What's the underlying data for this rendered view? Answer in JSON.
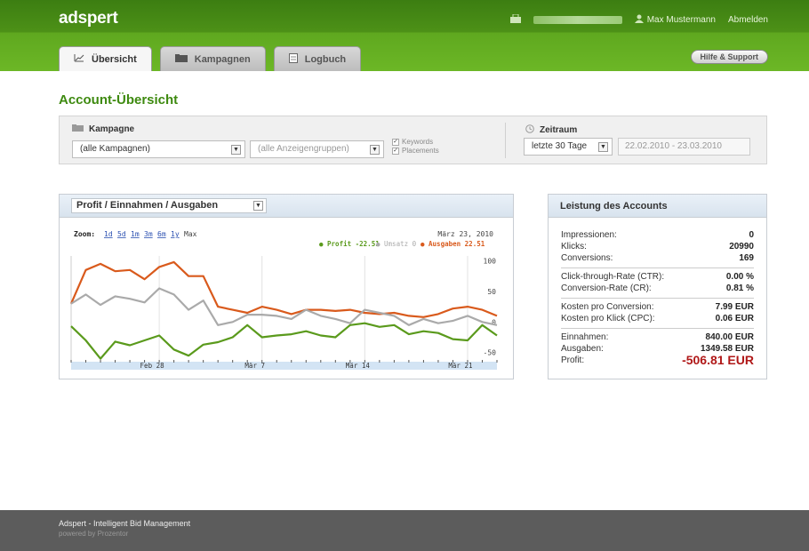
{
  "app": {
    "logo": "adspert"
  },
  "header": {
    "user_name": "Max Mustermann",
    "logout_label": "Abmelden",
    "help_label": "Hilfe & Support"
  },
  "tabs": [
    {
      "label": "Übersicht",
      "active": true
    },
    {
      "label": "Kampagnen",
      "active": false
    },
    {
      "label": "Logbuch",
      "active": false
    }
  ],
  "page": {
    "title": "Account-Übersicht"
  },
  "filters": {
    "campaign_label": "Kampagne",
    "campaign_value": "(alle Kampagnen)",
    "adgroup_value": "(alle Anzeigengruppen)",
    "keywords_label": "Keywords",
    "placements_label": "Placements",
    "period_label": "Zeitraum",
    "period_value": "letzte 30 Tage",
    "date_range": "22.02.2010 - 23.03.2010"
  },
  "chart_panel": {
    "selector": "Profit / Einnahmen / Ausgaben",
    "zoom_label": "Zoom:",
    "zoom_options": [
      "1d",
      "5d",
      "1m",
      "3m",
      "6m",
      "1y",
      "Max"
    ],
    "date_label": "März 23, 2010",
    "legend": [
      {
        "text": "● Profit -22.51",
        "color": "#5a9a1c"
      },
      {
        "text": "● Umsatz 0",
        "color": "#aaaaaa"
      },
      {
        "text": "● Ausgaben 22.51",
        "color": "#d95a1c"
      }
    ]
  },
  "chart_data": {
    "type": "line",
    "x": [
      "Feb 22",
      "Feb 23",
      "Feb 24",
      "Feb 25",
      "Feb 26",
      "Feb 27",
      "Feb 28",
      "Mar 1",
      "Mar 2",
      "Mar 3",
      "Mar 4",
      "Mar 5",
      "Mar 6",
      "Mar 7",
      "Mar 8",
      "Mar 9",
      "Mar 10",
      "Mar 11",
      "Mar 12",
      "Mar 13",
      "Mar 14",
      "Mar 15",
      "Mar 16",
      "Mar 17",
      "Mar 18",
      "Mar 19",
      "Mar 20",
      "Mar 21",
      "Mar 22",
      "Mar 23"
    ],
    "x_ticks": [
      "Feb 28",
      "Mär 7",
      "Mär 14",
      "Mär 21"
    ],
    "y_ticks": [
      100,
      50,
      0,
      -50
    ],
    "ylim": [
      -62,
      108
    ],
    "series": [
      {
        "name": "Ausgaben",
        "color": "#d95a1c",
        "values": [
          30,
          85,
          95,
          83,
          85,
          70,
          90,
          98,
          75,
          75,
          25,
          20,
          15,
          25,
          20,
          13,
          20,
          20,
          18,
          20,
          15,
          13,
          15,
          10,
          8,
          13,
          22,
          25,
          20,
          10
        ]
      },
      {
        "name": "Umsatz",
        "color": "#aaaaaa",
        "values": [
          30,
          45,
          28,
          42,
          38,
          32,
          55,
          45,
          20,
          35,
          -5,
          0,
          12,
          12,
          10,
          5,
          20,
          10,
          5,
          -2,
          20,
          15,
          10,
          -5,
          5,
          -2,
          2,
          10,
          0,
          -5
        ]
      },
      {
        "name": "Profit",
        "color": "#5a9a1c",
        "values": [
          -7,
          -30,
          -60,
          -32,
          -38,
          -30,
          -22,
          -45,
          -55,
          -37,
          -33,
          -25,
          -5,
          -25,
          -22,
          -20,
          -15,
          -22,
          -25,
          -5,
          -2,
          -8,
          -5,
          -20,
          -15,
          -18,
          -28,
          -30,
          -5,
          -22
        ]
      }
    ]
  },
  "stats": {
    "title": "Leistung des Accounts",
    "groups": [
      [
        {
          "label": "Impressionen:",
          "value": "0"
        },
        {
          "label": "Klicks:",
          "value": "20990"
        },
        {
          "label": "Conversions:",
          "value": "169"
        }
      ],
      [
        {
          "label": "Click-through-Rate (CTR):",
          "value": "0.00 %"
        },
        {
          "label": "Conversion-Rate (CR):",
          "value": "0.81 %"
        }
      ],
      [
        {
          "label": "Kosten pro Conversion:",
          "value": "7.99 EUR"
        },
        {
          "label": "Kosten pro Klick (CPC):",
          "value": "0.06 EUR"
        }
      ],
      [
        {
          "label": "Einnahmen:",
          "value": "840.00 EUR"
        },
        {
          "label": "Ausgaben:",
          "value": "1349.58 EUR"
        },
        {
          "label": "Profit:",
          "value": "-506.81 EUR"
        }
      ]
    ]
  },
  "footer": {
    "line1": "Adspert - Intelligent Bid Management",
    "line2": "powered by Prozentor"
  }
}
